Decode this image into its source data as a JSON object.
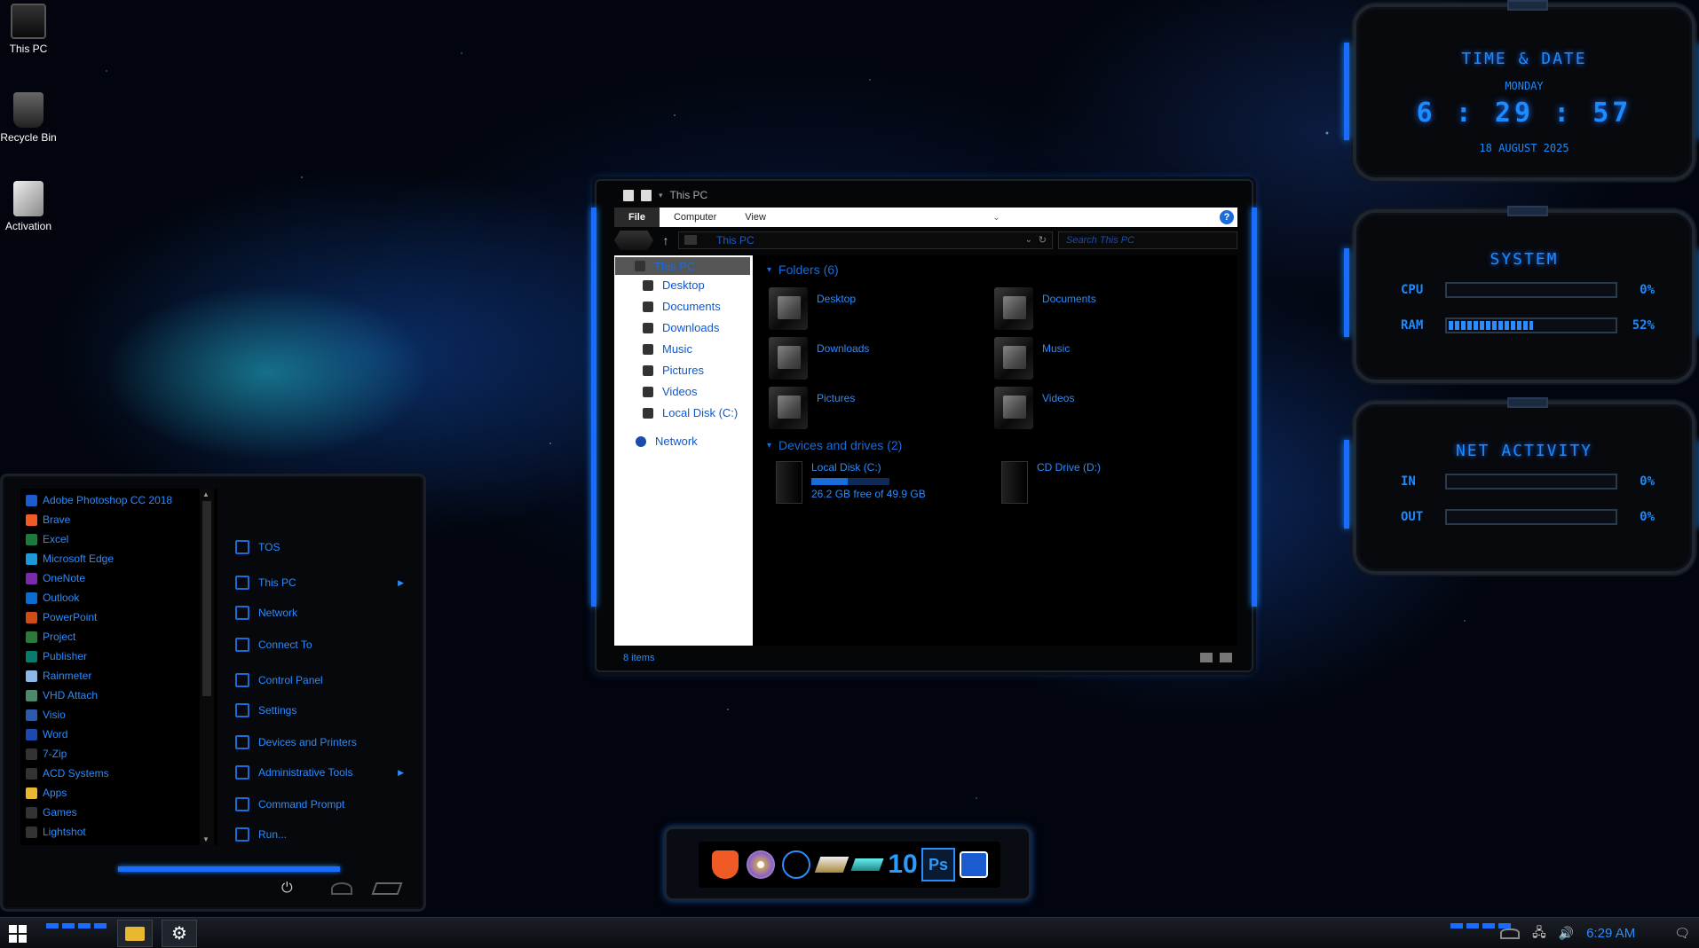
{
  "desktop": {
    "icons": [
      {
        "label": "This PC"
      },
      {
        "label": "Recycle Bin"
      },
      {
        "label": "Activation"
      }
    ]
  },
  "explorer": {
    "title": "This PC",
    "ribbon_tabs": [
      "File",
      "Computer",
      "View"
    ],
    "help": "?",
    "address": "This PC",
    "search_placeholder": "Search This PC",
    "nav": {
      "this_pc": "This PC",
      "items": [
        "Desktop",
        "Documents",
        "Downloads",
        "Music",
        "Pictures",
        "Videos",
        "Local Disk (C:)"
      ],
      "network": "Network"
    },
    "folders_header": "Folders (6)",
    "folders": [
      "Desktop",
      "Documents",
      "Downloads",
      "Music",
      "Pictures",
      "Videos"
    ],
    "drives_header": "Devices and drives (2)",
    "drives": [
      {
        "name": "Local Disk (C:)",
        "free": "26.2 GB free of 49.9 GB",
        "used_fraction": 0.47
      },
      {
        "name": "CD Drive (D:)"
      }
    ],
    "status": "8 items"
  },
  "start_menu": {
    "apps": [
      {
        "label": "Adobe Photoshop CC 2018",
        "color": "#1a5ccf"
      },
      {
        "label": "Brave",
        "color": "#f05a24"
      },
      {
        "label": "Excel",
        "color": "#1d7a3e"
      },
      {
        "label": "Microsoft Edge",
        "color": "#1a9bd8"
      },
      {
        "label": "OneNote",
        "color": "#7a2aa8"
      },
      {
        "label": "Outlook",
        "color": "#0a6cd0"
      },
      {
        "label": "PowerPoint",
        "color": "#d04a1a"
      },
      {
        "label": "Project",
        "color": "#2a7a3a"
      },
      {
        "label": "Publisher",
        "color": "#0a7a6a"
      },
      {
        "label": "Rainmeter",
        "color": "#8ab8e8"
      },
      {
        "label": "VHD Attach",
        "color": "#4a8a6a"
      },
      {
        "label": "Visio",
        "color": "#2a5aa8"
      },
      {
        "label": "Word",
        "color": "#1a4ab0"
      },
      {
        "label": "7-Zip",
        "color": "#333333"
      },
      {
        "label": "ACD Systems",
        "color": "#333333"
      },
      {
        "label": "Apps",
        "color": "#e8b830"
      },
      {
        "label": "Games",
        "color": "#333333"
      },
      {
        "label": "Lightshot",
        "color": "#333333"
      }
    ],
    "right_items": [
      {
        "label": "TOS",
        "arrow": ""
      },
      {
        "label": "This PC",
        "arrow": "▶"
      },
      {
        "label": "Network",
        "arrow": ""
      },
      {
        "label": "Connect To",
        "arrow": ""
      },
      {
        "label": "Control Panel",
        "arrow": ""
      },
      {
        "label": "Settings",
        "arrow": ""
      },
      {
        "label": "Devices and Printers",
        "arrow": ""
      },
      {
        "label": "Administrative Tools",
        "arrow": "▶"
      },
      {
        "label": "Command Prompt",
        "arrow": ""
      },
      {
        "label": "Run...",
        "arrow": ""
      }
    ],
    "power_icon": "⏻"
  },
  "dock": {
    "icons": [
      "brave-icon",
      "dvd-icon",
      "dots-icon",
      "drive-icon",
      "usb-icon",
      "windows10-icon",
      "photoshop-icon",
      "screenshot-icon"
    ],
    "labels": {
      "ten": "10",
      "ps": "Ps"
    }
  },
  "widgets": {
    "time": {
      "title": "TIME & DATE",
      "day": "MONDAY",
      "clock": "6 : 29 : 57",
      "date": "18 AUGUST 2025"
    },
    "system": {
      "title": "SYSTEM",
      "cpu_label": "CPU",
      "cpu_value": "0%",
      "cpu_fraction": 0.0,
      "ram_label": "RAM",
      "ram_value": "52%",
      "ram_fraction": 0.52
    },
    "net": {
      "title": "NET ACTIVITY",
      "in_label": "IN",
      "in_value": "0%",
      "in_fraction": 0.0,
      "out_label": "OUT",
      "out_value": "0%",
      "out_fraction": 0.0
    }
  },
  "taskbar": {
    "time": "6:29 AM",
    "gear": "⚙",
    "tray_icons": [
      "network-icon",
      "volume-icon",
      "notification-icon"
    ]
  },
  "colors": {
    "accent": "#1a8cff",
    "link": "#2a8cff"
  }
}
